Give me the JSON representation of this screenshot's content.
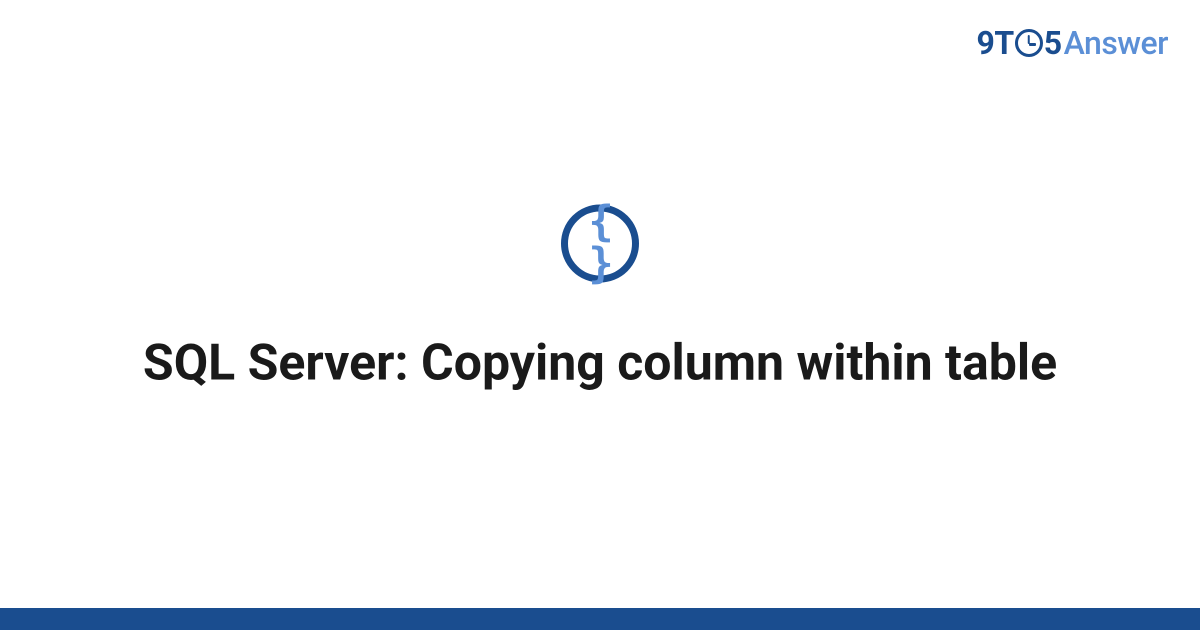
{
  "logo": {
    "part1": "9T",
    "part2": "5",
    "part3": "Answer"
  },
  "icon": {
    "braces_symbol": "{ }"
  },
  "title": "SQL Server: Copying column within table",
  "colors": {
    "brand_dark": "#1a4d8f",
    "brand_light": "#5b8fd6"
  }
}
